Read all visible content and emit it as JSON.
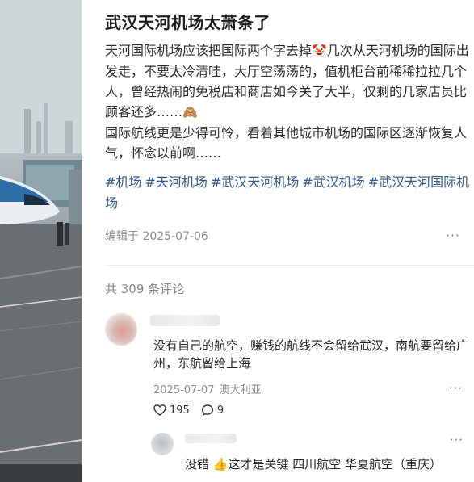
{
  "post": {
    "title": "武汉天河机场太萧条了",
    "body_part1": "天河国际机场应该把国际两个字去掉",
    "emoji1": "🤡",
    "body_part2": "几次从天河机场的国际出发走，不要太冷清哇，大厅空荡荡的，值机柜台前稀稀拉拉几个人，曾经热闹的免税店和商店如今关了大半，仅剩的几家店员比顾客还多……",
    "emoji2": "🙈",
    "body_part3": "国际航线更是少得可怜，看着其他城市机场的国际区逐渐恢复人气，怀念以前啊……",
    "tags": [
      "#机场",
      "#天河机场",
      "#武汉天河机场",
      "#武汉机场",
      "#武汉天河国际机场"
    ],
    "edited_at": "编辑于 2025-07-06",
    "more": "···"
  },
  "comments_header": {
    "count_text": "共 309 条评论"
  },
  "comment": {
    "text": "没有自己的航空，赚钱的航线不会留给武汉，南航要留给广州，东航留给上海",
    "date": "2025-07-07",
    "location": "澳大利亚",
    "likes": "195",
    "replies": "9",
    "more": "···"
  },
  "reply": {
    "text": "没错 👍这才是关键 四川航空 华夏航空（重庆）",
    "more": "···"
  }
}
